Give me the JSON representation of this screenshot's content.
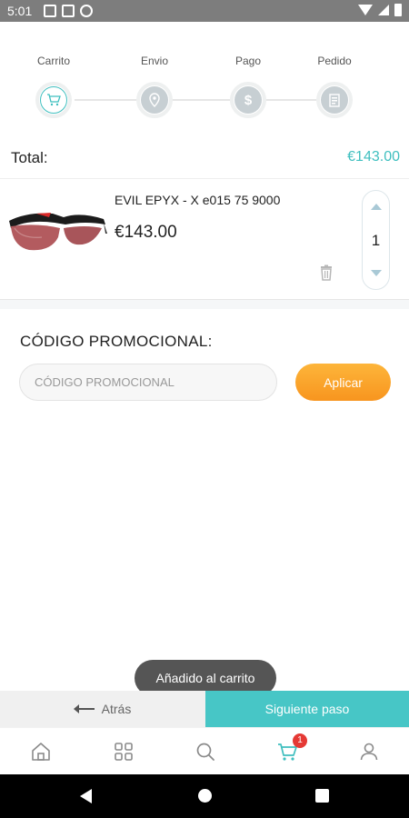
{
  "status_bar": {
    "time": "5:01"
  },
  "stepper": {
    "steps": [
      {
        "label": "Carrito",
        "icon": "cart-icon",
        "active": true
      },
      {
        "label": "Envio",
        "icon": "location-pin-icon",
        "active": false
      },
      {
        "label": "Pago",
        "icon": "dollar-icon",
        "active": false
      },
      {
        "label": "Pedido",
        "icon": "receipt-icon",
        "active": false
      }
    ]
  },
  "total": {
    "label": "Total:",
    "value": "€143.00"
  },
  "cart": {
    "items": [
      {
        "name": "EVIL EPYX - X e015 75 9000",
        "price": "€143.00",
        "quantity": "1"
      }
    ]
  },
  "promo": {
    "title": "CÓDIGO PROMOCIONAL:",
    "placeholder": "CÓDIGO PROMOCIONAL",
    "apply_label": "Aplicar"
  },
  "toast": {
    "text": "Añadido al carrito"
  },
  "footer": {
    "back_label": "Atrás",
    "next_label": "Siguiente paso"
  },
  "tabbar": {
    "tabs": [
      {
        "icon": "home-icon"
      },
      {
        "icon": "grid-icon"
      },
      {
        "icon": "search-icon"
      },
      {
        "icon": "cart-icon",
        "badge": "1",
        "active": true
      },
      {
        "icon": "user-icon"
      }
    ]
  },
  "colors": {
    "accent": "#3fbfbf",
    "button_orange": "#f8951f",
    "badge": "#e53935"
  }
}
